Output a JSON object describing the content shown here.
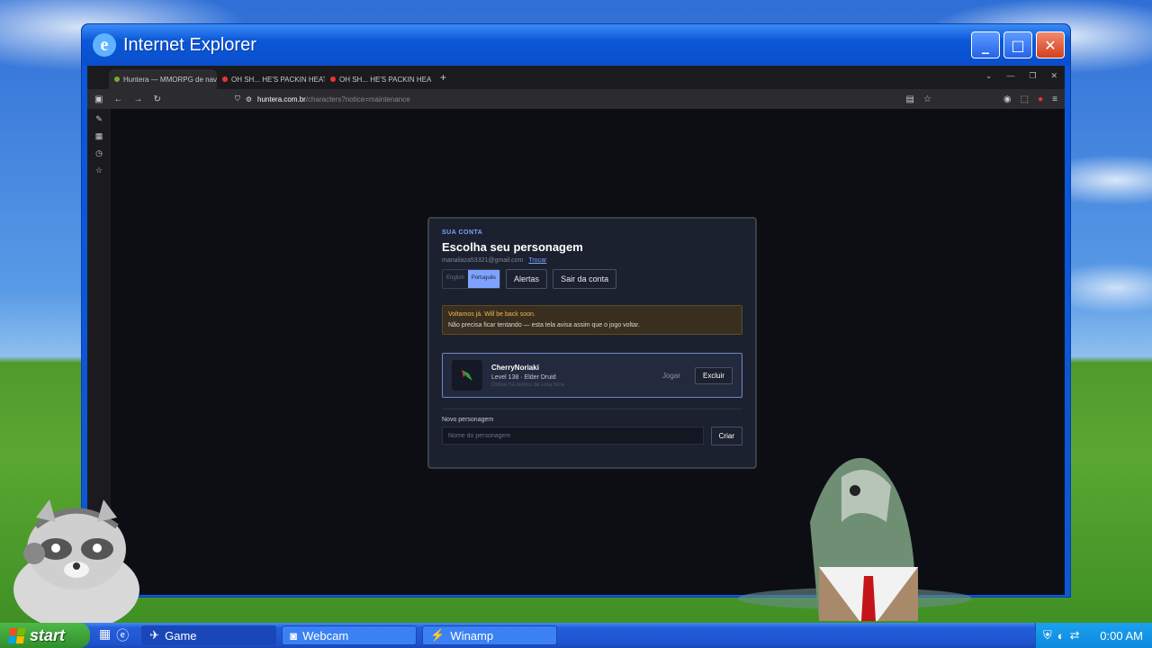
{
  "window": {
    "title": "Internet Explorer"
  },
  "browser": {
    "tabs": [
      {
        "label": "Huntera — MMORPG de naveg",
        "active": true
      },
      {
        "label": "OH SH... HE'S PACKIN HEAT!! |",
        "active": false
      },
      {
        "label": "OH SH... HE'S PACKIN HEA",
        "active": false
      }
    ],
    "url": {
      "host": "huntera.com.br",
      "path": "/characters?notice=maintenance"
    }
  },
  "card": {
    "kicker": "SUA CONTA",
    "title": "Escolha seu personagem",
    "email": "manaliaza53321@gmail.com",
    "swap_label": "Trocar",
    "lang_english": "English",
    "lang_portuguese": "Português",
    "alerts_label": "Alertas",
    "logout_label": "Sair da conta",
    "notice_title": "Voltamos já. Will be back soon.",
    "notice_text": "Não precisa ficar tentando — esta tela avisa assim que o jogo voltar.",
    "character": {
      "name": "CherryNoriaki",
      "level": "Level 138 · Elder Druid",
      "online": "Online há menos de uma hora",
      "play_label": "Jogar",
      "delete_label": "Excluir"
    },
    "new_label": "Novo personagem",
    "name_placeholder": "Nome do personagem",
    "create_label": "Criar"
  },
  "taskbar": {
    "start": "start",
    "tasks": [
      "Game",
      "Webcam",
      "Winamp"
    ],
    "clock": "0:00 AM"
  }
}
